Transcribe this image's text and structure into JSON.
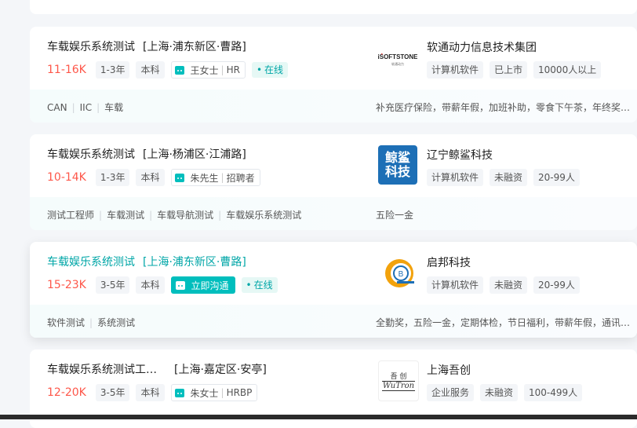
{
  "colors": {
    "salary": "#fe574a",
    "accent": "#00bebd",
    "online_text": "#00a6a7"
  },
  "jobs": [
    {
      "title": "车载娱乐系统测试",
      "location": "[上海·浦东新区·曹路]",
      "salary": "11-16K",
      "experience": "1-3年",
      "education": "本科",
      "recruiter_name": "王女士",
      "recruiter_title": "HR",
      "online": "在线",
      "company": "软通动力信息技术集团",
      "industry": "计算机软件",
      "stage": "已上市",
      "size": "10000人以上",
      "skills": [
        "CAN",
        "IIC",
        "车载"
      ],
      "welfare": "补充医疗保险，带薪年假，加班补助，零食下午茶，年终奖…"
    },
    {
      "title": "车载娱乐系统测试",
      "location": "[上海·杨浦区·江浦路]",
      "salary": "10-14K",
      "experience": "1-3年",
      "education": "本科",
      "recruiter_name": "朱先生",
      "recruiter_title": "招聘者",
      "company": "辽宁鲸鲨科技",
      "industry": "计算机软件",
      "stage": "未融资",
      "size": "20-99人",
      "skills": [
        "测试工程师",
        "车载测试",
        "车载导航测试",
        "车载娱乐系统测试"
      ],
      "welfare": "五险一金"
    },
    {
      "title": "车载娱乐系统测试",
      "location": "[上海·浦东新区·曹路]",
      "salary": "15-23K",
      "experience": "3-5年",
      "education": "本科",
      "chat_button": "立即沟通",
      "online": "在线",
      "company": "启邦科技",
      "industry": "计算机软件",
      "stage": "未融资",
      "size": "20-99人",
      "skills": [
        "软件测试",
        "系统测试"
      ],
      "welfare": "全勤奖，五险一金，定期体检，节日福利，带薪年假，通讯…"
    },
    {
      "title": "车载娱乐系统测试工…",
      "location": "[上海·嘉定区·安亭]",
      "salary": "12-20K",
      "experience": "3-5年",
      "education": "本科",
      "recruiter_name": "朱女士",
      "recruiter_title": "HRBP",
      "company": "上海吾创",
      "industry": "企业服务",
      "stage": "未融资",
      "size": "100-499人"
    }
  ],
  "logos": {
    "isoftstone": {
      "main": "iSOFTSTONE",
      "sub": "软通动力"
    },
    "jingsha": {
      "line1": "鲸鲨",
      "line2": "科技"
    },
    "wutron": {
      "line1": "吾 创",
      "line2": "WuTron"
    }
  }
}
